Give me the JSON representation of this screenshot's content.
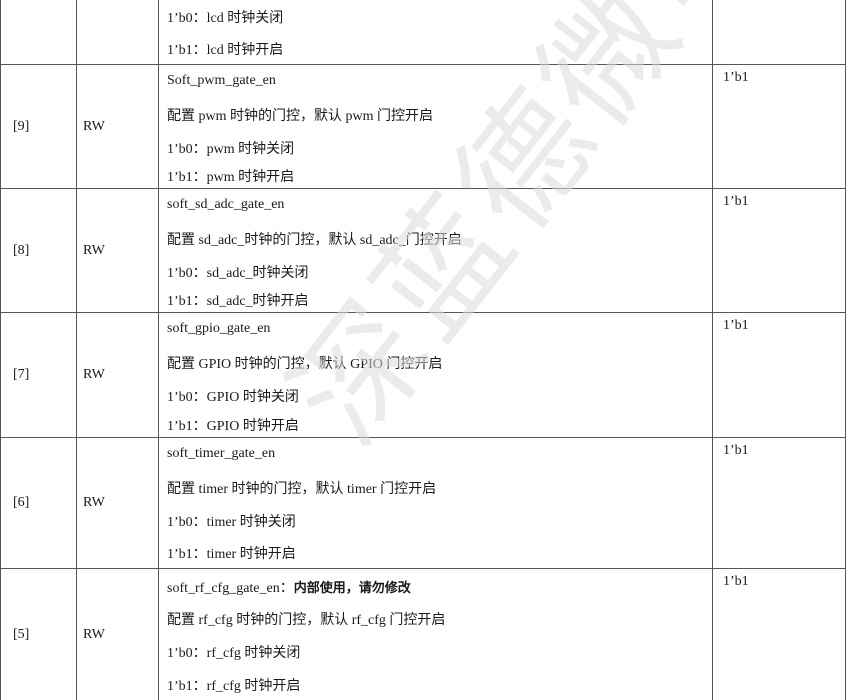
{
  "watermark": "深蓝德微电子",
  "top_partial": {
    "lines": [
      "1’b0：lcd 时钟关闭",
      "1’b1：lcd 时钟开启"
    ]
  },
  "rows": [
    {
      "bit": "[9]",
      "access": "RW",
      "reset": "1’b1",
      "name": "Soft_pwm_gate_en",
      "desc": "配置 pwm 时钟的门控，默认 pwm 门控开启",
      "opt0": "1’b0：pwm 时钟关闭",
      "opt1": "1’b1：pwm 时钟开启"
    },
    {
      "bit": "[8]",
      "access": "RW",
      "reset": "1’b1",
      "name": "soft_sd_adc_gate_en",
      "desc": "配置 sd_adc_时钟的门控，默认 sd_adc_门控开启",
      "opt0": "1’b0：sd_adc_时钟关闭",
      "opt1": "1’b1：sd_adc_时钟开启"
    },
    {
      "bit": "[7]",
      "access": "RW",
      "reset": "1’b1",
      "name": "soft_gpio_gate_en",
      "desc": "配置 GPIO 时钟的门控，默认 GPIO 门控开启",
      "opt0": "1’b0：GPIO 时钟关闭",
      "opt1": "1’b1：GPIO 时钟开启"
    },
    {
      "bit": "[6]",
      "access": "RW",
      "reset": "1’b1",
      "name": "soft_timer_gate_en",
      "desc": "配置 timer 时钟的门控，默认 timer 门控开启",
      "opt0": "1’b0：timer 时钟关闭",
      "opt1": "1’b1：timer 时钟开启"
    },
    {
      "bit": "[5]",
      "access": "RW",
      "reset": "1’b1",
      "name": "soft_rf_cfg_gate_en：",
      "name_note": "内部使用，请勿修改",
      "desc": "配置 rf_cfg 时钟的门控，默认 rf_cfg 门控开启",
      "opt0": "1’b0：rf_cfg 时钟关闭",
      "opt1": "1’b1：rf_cfg 时钟开启"
    }
  ]
}
